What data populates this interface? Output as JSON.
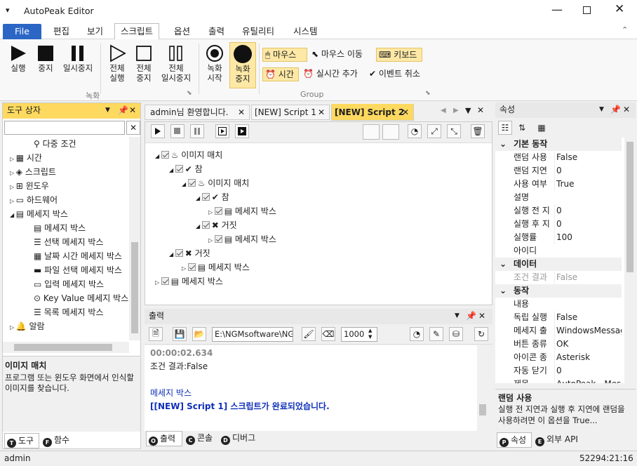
{
  "app": {
    "title": "AutoPeak Editor"
  },
  "menu": {
    "file": "File",
    "items": [
      "편집",
      "보기",
      "스크립트",
      "옵션",
      "출력",
      "유틸리티",
      "시스템"
    ]
  },
  "ribbon": {
    "buttons": {
      "run": "실행",
      "stop": "중지",
      "pause": "일시중지",
      "run_all": "전체\n실행",
      "stop_all": "전체\n중지",
      "pause_all": "전체\n일시중지",
      "rec_start": "녹화\n시작",
      "rec_stop": "녹화\n중지"
    },
    "small": {
      "mouse": "마우스",
      "mouse_move": "마우스 이동",
      "keyboard": "키보드",
      "time": "시간",
      "realtime_add": "실시간 추가",
      "event_cancel": "이벤트 취소"
    },
    "groups": {
      "record": "녹화",
      "group": "Group"
    }
  },
  "toolbox": {
    "title": "도구 상자",
    "items": [
      {
        "label": "다중 조건"
      },
      {
        "label": "시간"
      },
      {
        "label": "스크립트"
      },
      {
        "label": "윈도우"
      },
      {
        "label": "하드웨어"
      },
      {
        "label": "메세지 박스"
      },
      {
        "label": "메세지 박스"
      },
      {
        "label": "선택 메세지 박스"
      },
      {
        "label": "날짜 시간 메세지 박스"
      },
      {
        "label": "파일 선택 메세지 박스"
      },
      {
        "label": "입력 메세지 박스"
      },
      {
        "label": "Key Value 메세지 박스"
      },
      {
        "label": "목록 메세지 박스"
      },
      {
        "label": "알람"
      }
    ],
    "desc_title": "이미지 매치",
    "desc_text": "프로그램 또는 윈도우 화면에서 인식할 이미지를 찾습니다.",
    "tabs": [
      "도구",
      "함수"
    ]
  },
  "editor": {
    "tabs": [
      "admin님 환영합니다.",
      "[NEW] Script 1",
      "[NEW] Script 2"
    ],
    "tree": [
      "이미지 매치",
      "참",
      "이미지 매치",
      "참",
      "메세지 박스",
      "거짓",
      "메세지 박스",
      "거짓",
      "메세지 박스",
      "메세지 박스"
    ]
  },
  "output": {
    "title": "출력",
    "path": "E:\\NGMsoftware\\NG",
    "count": "1000",
    "lines": [
      "00:00:02.634",
      "조건 결과:False",
      "",
      "메세지 박스",
      "[[NEW] Script 1] 스크립트가 완료되었습니다."
    ],
    "tabs": [
      "출력",
      "콘솔",
      "디버그"
    ]
  },
  "properties": {
    "title": "속성",
    "sections": [
      {
        "name": "기본 동작",
        "rows": [
          [
            "랜덤 사용",
            "False"
          ],
          [
            "랜덤 지연",
            "0"
          ],
          [
            "사용 여부",
            "True"
          ],
          [
            "설명",
            ""
          ],
          [
            "실행 전 지",
            "0"
          ],
          [
            "실행 후 지",
            "0"
          ],
          [
            "실행률",
            "100"
          ],
          [
            "아이디",
            ""
          ]
        ]
      },
      {
        "name": "데이터",
        "rows": [
          [
            "조건 결과",
            "False"
          ]
        ]
      },
      {
        "name": "동작",
        "rows": [
          [
            "내용",
            ""
          ],
          [
            "독립 실행",
            "False"
          ],
          [
            "메세지 출",
            "WindowsMessage"
          ],
          [
            "버튼 종류",
            "OK"
          ],
          [
            "아이콘 종",
            "Asterisk"
          ],
          [
            "자동 닫기",
            "0"
          ],
          [
            "제목",
            "AutoPeak - Messa"
          ]
        ]
      }
    ],
    "desc_title": "랜덤 사용",
    "desc_text": "실행 전 지연과 실행 후 지연에 랜덤을 사용하려면 이 옵션을 True...",
    "tabs": [
      "속성",
      "외부 API"
    ]
  },
  "status": {
    "user": "admin",
    "right": "52294:21:16"
  }
}
